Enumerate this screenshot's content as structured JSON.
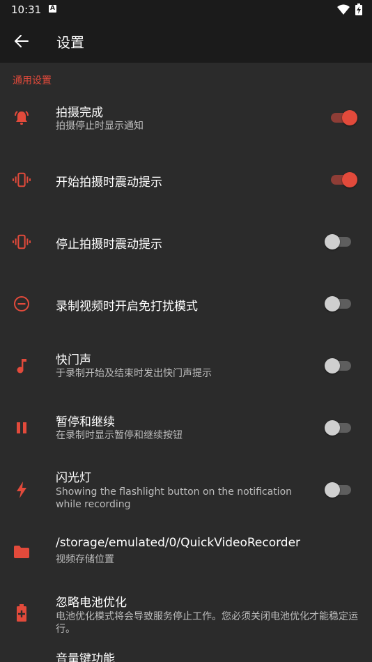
{
  "status_bar": {
    "time": "10:31",
    "notification_icon": "A"
  },
  "app_bar": {
    "title": "设置"
  },
  "section": {
    "general": "通用设置"
  },
  "settings": [
    {
      "title": "拍摄完成",
      "subtitle": "拍摄停止时显示通知",
      "icon": "bell-ringing-icon",
      "toggle": true
    },
    {
      "title": "开始拍摄时震动提示",
      "subtitle": "",
      "icon": "vibrate-icon",
      "toggle": true
    },
    {
      "title": "停止拍摄时震动提示",
      "subtitle": "",
      "icon": "vibrate-icon",
      "toggle": false
    },
    {
      "title": "录制视频时开启免打扰模式",
      "subtitle": "",
      "icon": "do-not-disturb-icon",
      "toggle": false
    },
    {
      "title": "快门声",
      "subtitle": "于录制开始及结束时发出快门声提示",
      "icon": "music-note-icon",
      "toggle": false
    },
    {
      "title": "暂停和继续",
      "subtitle": "在录制时显示暂停和继续按钮",
      "icon": "pause-icon",
      "toggle": false
    },
    {
      "title": "闪光灯",
      "subtitle": "Showing the flashlight button on the notification while recording",
      "icon": "flash-icon",
      "toggle": false
    },
    {
      "title": "/storage/emulated/0/QuickVideoRecorder",
      "subtitle": "视频存储位置",
      "icon": "folder-icon"
    },
    {
      "title": "忽略电池优化",
      "subtitle": "电池优化模式将会导致服务停止工作。您必须关闭电池优化才能稳定运行。",
      "icon": "battery-charging-icon"
    },
    {
      "title": "音量键功能",
      "subtitle": ""
    }
  ],
  "colors": {
    "accent": "#e24a3b",
    "background": "#2b2b2b",
    "bar": "#1b1b1b"
  }
}
